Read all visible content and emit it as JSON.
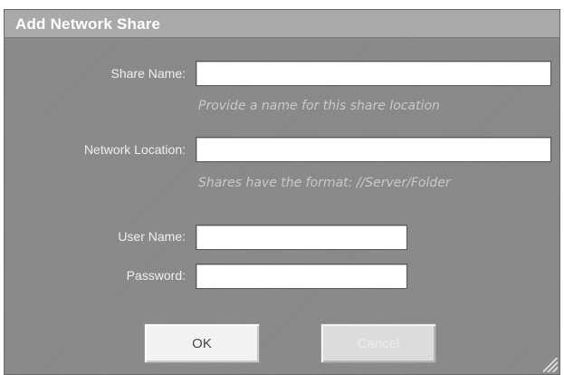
{
  "dialog": {
    "title": "Add Network Share"
  },
  "form": {
    "share_name": {
      "label": "Share Name:",
      "value": "",
      "hint": "Provide a name for this share location"
    },
    "network_location": {
      "label": "Network Location:",
      "value": "",
      "hint": "Shares have the format: //Server/Folder"
    },
    "user_name": {
      "label": "User Name:",
      "value": ""
    },
    "password": {
      "label": "Password:",
      "value": ""
    }
  },
  "buttons": {
    "ok_label": "OK",
    "cancel_label": "Cancel"
  },
  "icons": {
    "resize": "resize-grip-icon"
  }
}
